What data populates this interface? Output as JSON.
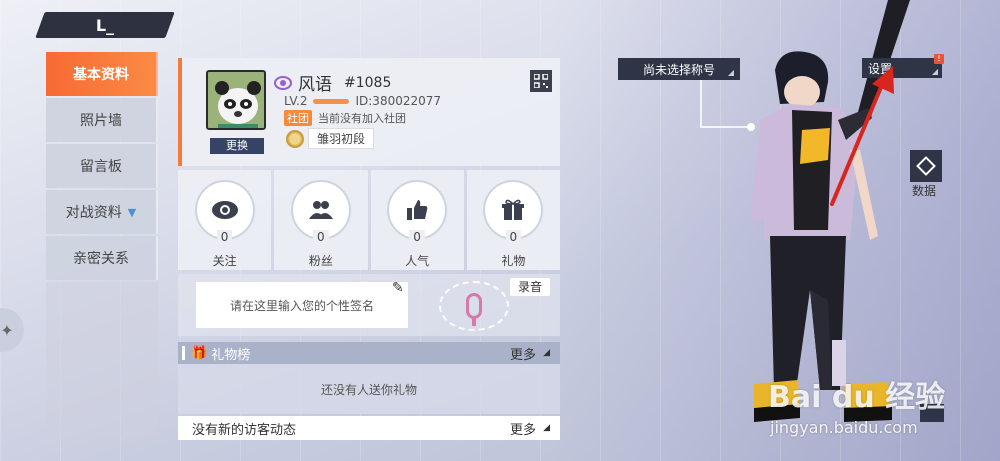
{
  "nav": {
    "items": [
      {
        "label": "基本资料",
        "active": true
      },
      {
        "label": "照片墙"
      },
      {
        "label": "留言板"
      },
      {
        "label": "对战资料",
        "has_chevron": true
      },
      {
        "label": "亲密关系"
      }
    ]
  },
  "profile": {
    "name": "风语",
    "tag": "#1085",
    "level": "LV.2",
    "id": "ID:380022077",
    "club_tag": "社团",
    "club_text": "当前没有加入社团",
    "rank": "雏羽初段",
    "change_avatar": "更换"
  },
  "stats": [
    {
      "label": "关注",
      "value": "0",
      "icon": "eye-icon"
    },
    {
      "label": "粉丝",
      "value": "0",
      "icon": "fans-icon"
    },
    {
      "label": "人气",
      "value": "0",
      "icon": "thumbs-up-icon"
    },
    {
      "label": "礼物",
      "value": "0",
      "icon": "gift-icon"
    }
  ],
  "signature": {
    "placeholder": "请在这里输入您的个性签名",
    "record_label": "录音"
  },
  "gift_board": {
    "title": "礼物榜",
    "more": "更多",
    "empty_text": "还没有人送你礼物"
  },
  "visitors": {
    "text": "没有新的访客动态",
    "more": "更多"
  },
  "right": {
    "title_select": "尚未选择称号",
    "settings": "设置",
    "settings_alert": "!",
    "data_label": "数据"
  },
  "watermark": {
    "main": "Bai du 经验",
    "sub": "jingyan.baidu.com"
  },
  "colors": {
    "accent": "#f76a34",
    "panel_dark": "#2f3446",
    "arrow": "#d8261e"
  }
}
